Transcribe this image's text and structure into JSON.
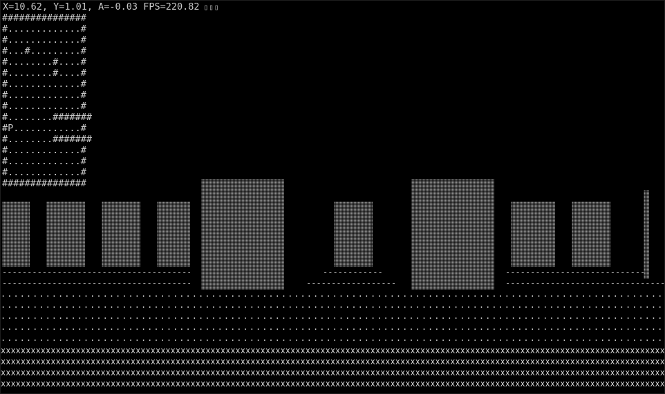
{
  "hud": {
    "status": "X=10.62, Y=1.01, A=-0.03 FPS=220.82",
    "unknown_glyphs": "▯▯▯"
  },
  "minimap": {
    "rows": [
      "###############",
      "#.............#",
      "#.............#",
      "#...#.........#",
      "#........#....#",
      "#........#....#",
      "#.............#",
      "#.............#",
      "#.............#",
      "#........#######",
      "#P............#",
      "#........#######",
      "#.............#",
      "#.............#",
      "#.............#",
      "###############"
    ]
  },
  "render": {
    "wall_shade": "▒",
    "near_floor_char": "-",
    "mid_floor_char": ".",
    "far_floor_char": "x"
  },
  "colors": {
    "background": "#000000",
    "text": "#c8c8c8",
    "wall": "#8c8c8c"
  }
}
